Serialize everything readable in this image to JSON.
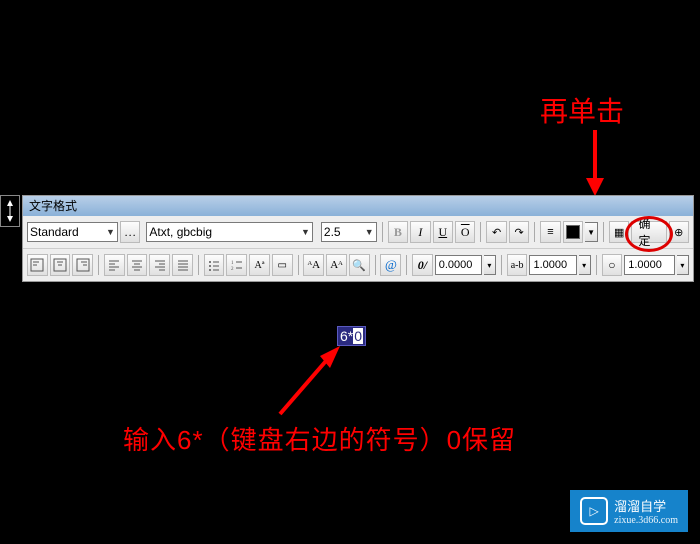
{
  "annotations": {
    "top": "再单击",
    "bottom": "输入6*（键盘右边的符号）0保留"
  },
  "toolbar": {
    "title": "文字格式",
    "style": "Standard",
    "font": "txt, gbcbig",
    "size": "2.5",
    "bold": "B",
    "italic": "I",
    "underline": "U",
    "overline": "O",
    "ok": "确定"
  },
  "row2": {
    "tracking": "0.0000",
    "width_factor": "1.0000",
    "oblique": "1.0000",
    "ab_label": "a-b",
    "at": "@",
    "slash": "0/"
  },
  "canvas": {
    "input_value": "6*",
    "input_cursor": "0"
  },
  "watermark": {
    "brand": "溜溜自学",
    "url": "zixue.3d66.com"
  }
}
